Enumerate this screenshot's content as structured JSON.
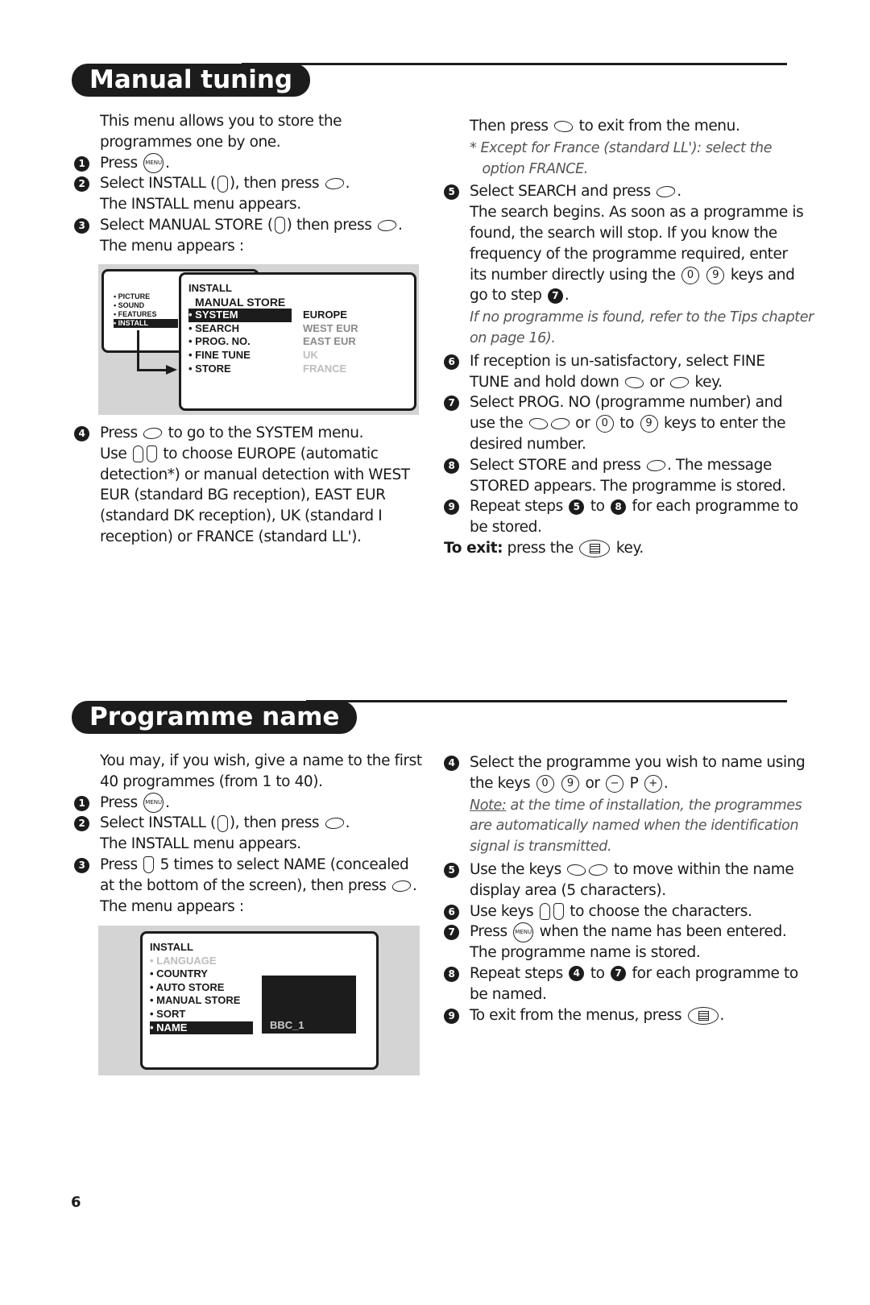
{
  "sections": {
    "manual_tuning": {
      "title": "Manual tuning",
      "left": [
        {
          "lines": [
            [
              {
                "t": "This menu allows you to store the"
              }
            ],
            [
              {
                "t": "programmes one by one."
              }
            ]
          ]
        },
        {
          "bullet": "1",
          "lines": [
            [
              {
                "t": "Press "
              },
              {
                "k": "menu",
                "v": "MENU"
              },
              {
                "t": "."
              }
            ]
          ]
        },
        {
          "bullet": "2",
          "lines": [
            [
              {
                "t": "Select INSTALL ("
              },
              {
                "k": "updown"
              },
              {
                "t": "), then press "
              },
              {
                "k": "right"
              },
              {
                "t": "."
              }
            ],
            [
              {
                "t": "The INSTALL menu appears."
              }
            ]
          ]
        },
        {
          "bullet": "3",
          "lines": [
            [
              {
                "t": "Select MANUAL STORE ("
              },
              {
                "k": "updown"
              },
              {
                "t": ") then press "
              },
              {
                "k": "right"
              },
              {
                "t": "."
              }
            ],
            [
              {
                "t": "The menu appears :"
              }
            ]
          ]
        }
      ],
      "left2": [
        {
          "bullet": "4",
          "lines": [
            [
              {
                "t": "Press "
              },
              {
                "k": "right"
              },
              {
                "t": " to go to the SYSTEM menu."
              }
            ],
            [
              {
                "t": "Use "
              },
              {
                "k": "up"
              },
              {
                "k": "down"
              },
              {
                "t": " to choose EUROPE (automatic"
              }
            ],
            [
              {
                "t": "detection*) or manual detection with WEST"
              }
            ],
            [
              {
                "t": "EUR (standard BG reception), EAST EUR"
              }
            ],
            [
              {
                "t": "(standard DK reception), UK (standard I"
              }
            ],
            [
              {
                "t": "reception) or FRANCE (standard LL')."
              }
            ]
          ]
        }
      ],
      "right": [
        {
          "lines": [
            [
              {
                "t": "Then press "
              },
              {
                "k": "left"
              },
              {
                "t": " to exit from the menu."
              }
            ]
          ]
        },
        {
          "style": "it",
          "lines": [
            [
              {
                "t": "* Except for France (standard LL'): select the"
              }
            ],
            [
              {
                "t": "   option FRANCE."
              }
            ]
          ]
        },
        {
          "bullet": "5",
          "lines": [
            [
              {
                "t": "Select SEARCH and press "
              },
              {
                "k": "right"
              },
              {
                "t": "."
              }
            ],
            [
              {
                "t": "The search begins. As soon as a programme is"
              }
            ],
            [
              {
                "t": "found, the search will stop. If you know the"
              }
            ],
            [
              {
                "t": "frequency of the programme required, enter"
              }
            ],
            [
              {
                "t": "its number directly using the "
              },
              {
                "k": "num",
                "v": "0"
              },
              {
                "t": " "
              },
              {
                "k": "num",
                "v": "9"
              },
              {
                "t": " keys and"
              }
            ],
            [
              {
                "t": "go to step "
              },
              {
                "k": "step",
                "v": "7"
              },
              {
                "t": "."
              }
            ]
          ]
        },
        {
          "style": "it",
          "lines": [
            [
              {
                "t": "If no programme is found, refer to the Tips chapter"
              }
            ],
            [
              {
                "t": "on page 16)."
              }
            ]
          ]
        },
        {
          "bullet": "6",
          "lines": [
            [
              {
                "t": "If reception is un-satisfactory, select FINE"
              }
            ],
            [
              {
                "t": "TUNE and hold down "
              },
              {
                "k": "left"
              },
              {
                "t": " or "
              },
              {
                "k": "right"
              },
              {
                "t": " key."
              }
            ]
          ]
        },
        {
          "bullet": "7",
          "lines": [
            [
              {
                "t": "Select PROG. NO (programme number) and"
              }
            ],
            [
              {
                "t": "use the "
              },
              {
                "k": "left"
              },
              {
                "k": "right"
              },
              {
                "t": " or "
              },
              {
                "k": "num",
                "v": "0"
              },
              {
                "t": " to "
              },
              {
                "k": "num",
                "v": "9"
              },
              {
                "t": " keys to enter the"
              }
            ],
            [
              {
                "t": "desired number."
              }
            ]
          ]
        },
        {
          "bullet": "8",
          "lines": [
            [
              {
                "t": "Select STORE and press "
              },
              {
                "k": "right"
              },
              {
                "t": ". The message"
              }
            ],
            [
              {
                "t": "STORED appears. The programme is stored."
              }
            ]
          ]
        },
        {
          "bullet": "9",
          "lines": [
            [
              {
                "t": "Repeat steps "
              },
              {
                "k": "step",
                "v": "5"
              },
              {
                "t": " to "
              },
              {
                "k": "step",
                "v": "8"
              },
              {
                "t": " for each programme to"
              }
            ],
            [
              {
                "t": "be stored."
              }
            ]
          ]
        },
        {
          "outdent": true,
          "lines": [
            [
              {
                "t": "To exit:",
                "b": true
              },
              {
                "t": " press the "
              },
              {
                "k": "tv"
              },
              {
                "t": " key."
              }
            ]
          ]
        }
      ],
      "menu": {
        "main_items": [
          "• PICTURE",
          "• SOUND",
          "• FEATURES",
          "• INSTALL"
        ],
        "title": "INSTALL",
        "subtitle": "MANUAL STORE",
        "items": [
          "• SYSTEM",
          "• SEARCH",
          "• PROG. NO.",
          "• FINE TUNE",
          "• STORE"
        ],
        "options": [
          "EUROPE",
          "WEST EUR",
          "EAST EUR",
          "UK",
          "FRANCE"
        ]
      }
    },
    "programme_name": {
      "title": "Programme name",
      "left": [
        {
          "lines": [
            [
              {
                "t": "You may, if you wish, give a name to the first"
              }
            ],
            [
              {
                "t": "40 programmes (from 1 to 40)."
              }
            ]
          ]
        },
        {
          "bullet": "1",
          "lines": [
            [
              {
                "t": "Press "
              },
              {
                "k": "menu",
                "v": "MENU"
              },
              {
                "t": "."
              }
            ]
          ]
        },
        {
          "bullet": "2",
          "lines": [
            [
              {
                "t": "Select INSTALL ("
              },
              {
                "k": "updown"
              },
              {
                "t": "), then press "
              },
              {
                "k": "right"
              },
              {
                "t": "."
              }
            ],
            [
              {
                "t": "The INSTALL menu appears."
              }
            ]
          ]
        },
        {
          "bullet": "3",
          "lines": [
            [
              {
                "t": "Press "
              },
              {
                "k": "down"
              },
              {
                "t": " 5 times to select NAME (concealed"
              }
            ],
            [
              {
                "t": "at the bottom of the screen), then press "
              },
              {
                "k": "right"
              },
              {
                "t": "."
              }
            ],
            [
              {
                "t": "The menu appears :"
              }
            ]
          ]
        }
      ],
      "right": [
        {
          "bullet": "4",
          "lines": [
            [
              {
                "t": "Select the programme you wish to name using"
              }
            ],
            [
              {
                "t": "the keys "
              },
              {
                "k": "num",
                "v": "0"
              },
              {
                "t": " "
              },
              {
                "k": "num",
                "v": "9"
              },
              {
                "t": " or "
              },
              {
                "k": "pm",
                "v": "−"
              },
              {
                "t": " P "
              },
              {
                "k": "pm",
                "v": "+"
              },
              {
                "t": "."
              }
            ]
          ]
        },
        {
          "style": "it",
          "lines": [
            [
              {
                "t": "Note:",
                "u": true
              },
              {
                "t": " at the time of installation, the programmes"
              }
            ],
            [
              {
                "t": "are automatically named when the identification"
              }
            ],
            [
              {
                "t": "signal is transmitted."
              }
            ]
          ]
        },
        {
          "bullet": "5",
          "lines": [
            [
              {
                "t": "Use the keys "
              },
              {
                "k": "left"
              },
              {
                "k": "right"
              },
              {
                "t": " to move within the name"
              }
            ],
            [
              {
                "t": "display area (5 characters)."
              }
            ]
          ]
        },
        {
          "bullet": "6",
          "lines": [
            [
              {
                "t": "Use keys "
              },
              {
                "k": "up"
              },
              {
                "k": "down"
              },
              {
                "t": " to choose the characters."
              }
            ]
          ]
        },
        {
          "bullet": "7",
          "lines": [
            [
              {
                "t": "Press "
              },
              {
                "k": "menu",
                "v": "MENU"
              },
              {
                "t": " when the name has been entered."
              }
            ],
            [
              {
                "t": "The programme name is stored."
              }
            ]
          ]
        },
        {
          "bullet": "8",
          "lines": [
            [
              {
                "t": "Repeat steps "
              },
              {
                "k": "step",
                "v": "4"
              },
              {
                "t": " to "
              },
              {
                "k": "step",
                "v": "7"
              },
              {
                "t": " for each programme to"
              }
            ],
            [
              {
                "t": "be named."
              }
            ]
          ]
        },
        {
          "bullet": "9",
          "lines": [
            [
              {
                "t": "To exit from the menus, press "
              },
              {
                "k": "tv"
              },
              {
                "t": "."
              }
            ]
          ]
        }
      ],
      "menu": {
        "title": "INSTALL",
        "items": [
          "• LANGUAGE",
          "• COUNTRY",
          "• AUTO STORE",
          "• MANUAL STORE",
          "• SORT",
          "• NAME"
        ],
        "name_value": "BBC_1"
      }
    }
  },
  "page_number": "6"
}
